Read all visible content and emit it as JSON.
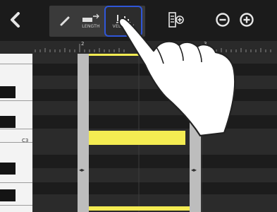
{
  "toolbar": {
    "length_label": "LENGTH",
    "velocity_label": "VELOCITY"
  },
  "ruler": {
    "bar_2": "2",
    "bar_3": "3"
  },
  "piano": {
    "c3_label": "C3"
  }
}
